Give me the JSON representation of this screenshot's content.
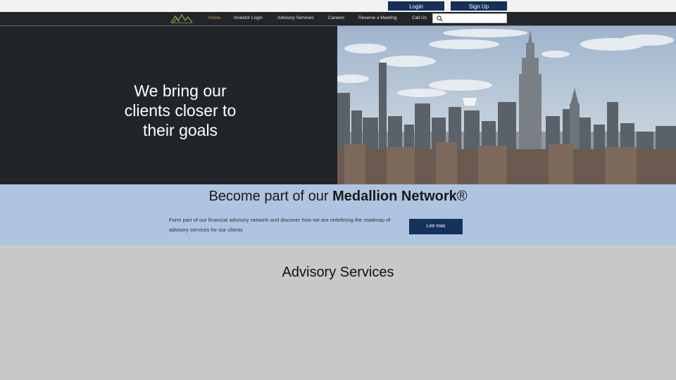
{
  "auth": {
    "login_label": "Login",
    "signup_label": "Sign Up"
  },
  "nav": {
    "items": [
      {
        "label": "Home",
        "active": true
      },
      {
        "label": "Investor Login",
        "active": false
      },
      {
        "label": "Advisory Services",
        "active": false
      },
      {
        "label": "Careers",
        "active": false
      },
      {
        "label": "Reserve a Meeting",
        "active": false
      },
      {
        "label": "Call Us",
        "active": false
      }
    ],
    "search": {
      "value": "",
      "placeholder": ""
    }
  },
  "hero": {
    "title": "We bring our clients closer to their goals"
  },
  "network": {
    "title_prefix": "Become part of our ",
    "title_brand": "Medallion Network",
    "title_suffix": "®",
    "description": "Form part of our financial advisory network and discover how we are redefining the roadmap of advisory services for our clients",
    "button_label": "Lee mas"
  },
  "advisory": {
    "title": "Advisory Services"
  },
  "colors": {
    "navy": "#15325c",
    "active_nav": "#c69c3f",
    "band": "#afc4e0",
    "dark": "#222528",
    "page": "#c8c8c8"
  }
}
